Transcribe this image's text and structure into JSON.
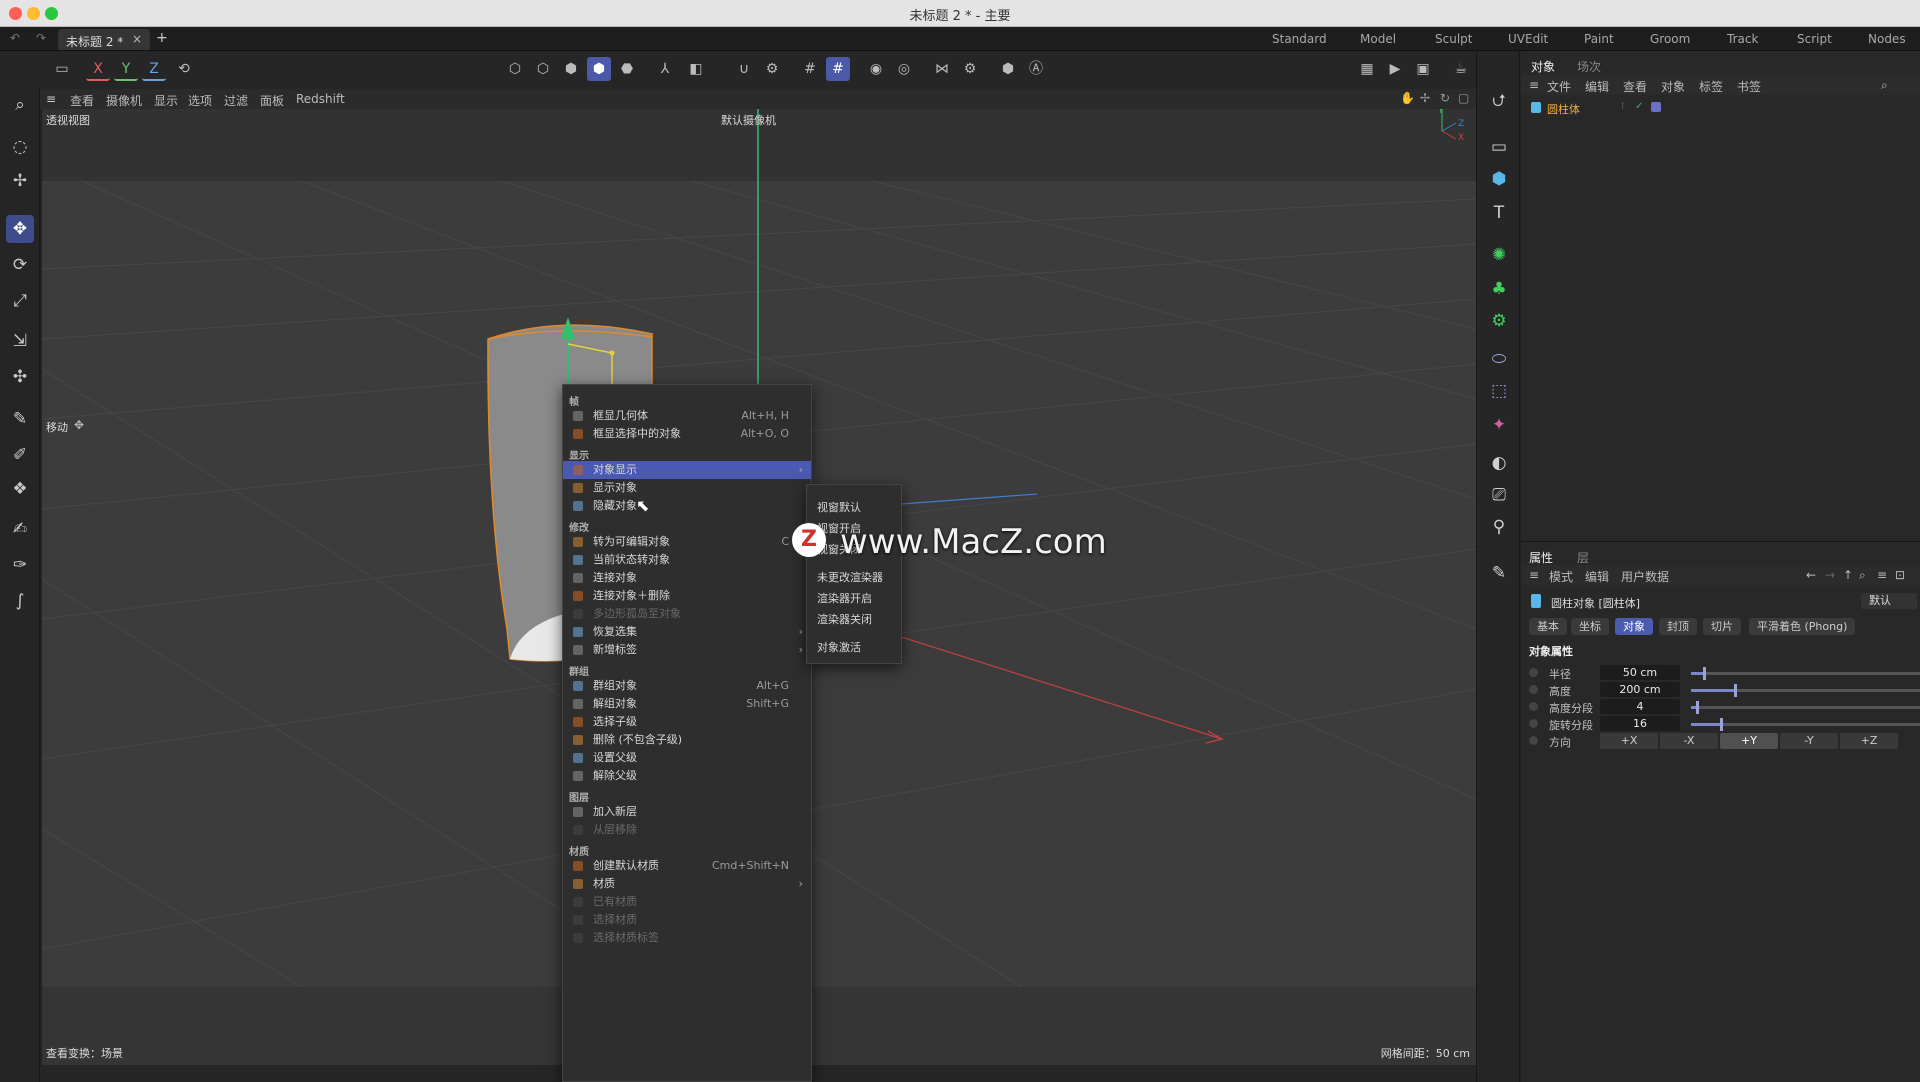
{
  "window": {
    "title": "未标题 2 * - 主要"
  },
  "tabs": {
    "doc_tab": "未标题 2 *",
    "close": "×",
    "add": "+"
  },
  "layouts": [
    "Standard",
    "Model",
    "Sculpt",
    "UVEdit",
    "Paint",
    "Groom",
    "Track",
    "Script",
    "Nodes"
  ],
  "axis_buttons": {
    "x": "X",
    "y": "Y",
    "z": "Z"
  },
  "viewport_menu": [
    "查看",
    "摄像机",
    "显示",
    "选项",
    "过滤",
    "面板",
    "Redshift"
  ],
  "viewport": {
    "name": "透视视图",
    "camera": "默认摄像机",
    "tool_label": "移动",
    "view_transform": "查看变换：场景",
    "grid_spacing": "网格间距：50 cm",
    "axis_y": "Y",
    "axis_z": "Z",
    "axis_x": "X"
  },
  "context_menu": {
    "sections": [
      {
        "header": "帧",
        "items": [
          {
            "label": "框显几何体",
            "shortcut": "Alt+H, H"
          },
          {
            "label": "框显选择中的对象",
            "shortcut": "Alt+O, O"
          }
        ]
      },
      {
        "header": "显示",
        "items": [
          {
            "label": "对象显示",
            "submenu": true,
            "highlighted": true
          },
          {
            "label": "显示对象"
          },
          {
            "label": "隐藏对象"
          }
        ]
      },
      {
        "header": "修改",
        "items": [
          {
            "label": "转为可编辑对象",
            "shortcut": "C"
          },
          {
            "label": "当前状态转对象"
          },
          {
            "label": "连接对象"
          },
          {
            "label": "连接对象＋删除"
          },
          {
            "label": "多边形孤岛至对象",
            "disabled": true
          },
          {
            "label": "恢复选集",
            "submenu": true
          },
          {
            "label": "新增标签",
            "submenu": true
          }
        ]
      },
      {
        "header": "群组",
        "items": [
          {
            "label": "群组对象",
            "shortcut": "Alt+G"
          },
          {
            "label": "解组对象",
            "shortcut": "Shift+G"
          },
          {
            "label": "选择子级"
          },
          {
            "label": "删除 (不包含子级)"
          },
          {
            "label": "设置父级"
          },
          {
            "label": "解除父级"
          }
        ]
      },
      {
        "header": "图层",
        "items": [
          {
            "label": "加入新层"
          },
          {
            "label": "从层移除",
            "disabled": true
          }
        ]
      },
      {
        "header": "材质",
        "items": [
          {
            "label": "创建默认材质",
            "shortcut": "Cmd+Shift+N"
          },
          {
            "label": "材质",
            "submenu": true
          },
          {
            "label": "已有材质",
            "disabled": true
          },
          {
            "label": "选择材质",
            "disabled": true
          },
          {
            "label": "选择材质标签",
            "disabled": true
          }
        ]
      }
    ]
  },
  "submenu": [
    "视窗默认",
    "视窗开启",
    "视窗关闭",
    "未更改渲染器",
    "渲染器开启",
    "渲染器关闭",
    "对象激活"
  ],
  "watermark": "www.MacZ.com",
  "object_panel": {
    "tabs": [
      "对象",
      "场次"
    ],
    "menu": [
      "文件",
      "编辑",
      "查看",
      "对象",
      "标签",
      "书签"
    ],
    "objects": [
      {
        "name": "圆柱体"
      }
    ]
  },
  "attr_panel": {
    "tabs": [
      "属性",
      "层"
    ],
    "menu": [
      "模式",
      "编辑",
      "用户数据"
    ],
    "object_title": "圆柱对象 [圆柱体]",
    "preset": "默认",
    "attr_tabs": [
      "基本",
      "坐标",
      "对象",
      "封顶",
      "切片",
      "平滑着色 (Phong)"
    ],
    "section": "对象属性",
    "params": [
      {
        "label": "半径",
        "value": "50 cm",
        "level": 0.05
      },
      {
        "label": "高度",
        "value": "200 cm",
        "level": 0.18
      },
      {
        "label": "高度分段",
        "value": "4",
        "level": 0.02
      },
      {
        "label": "旋转分段",
        "value": "16",
        "level": 0.12
      }
    ],
    "direction_label": "方向",
    "directions": [
      "+X",
      "-X",
      "+Y",
      "-Y",
      "+Z"
    ],
    "direction_selected": "+Y"
  },
  "colors": {
    "accent": "#4a5ab0",
    "selection_orange": "#e08a2c",
    "axis_y": "#3dbf6a",
    "axis_x": "#d04040",
    "axis_z": "#3a7fd0"
  }
}
